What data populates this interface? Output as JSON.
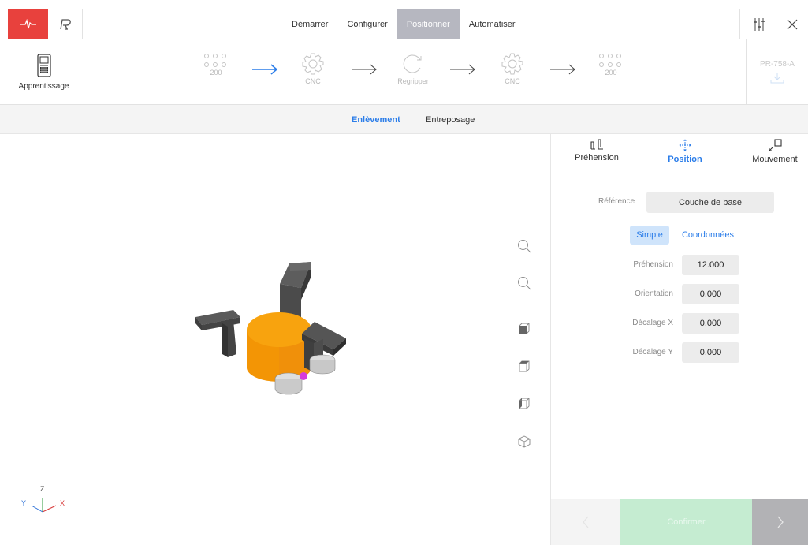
{
  "topbar": {
    "logo_icon": "pulse-icon",
    "brand_icon": "robotiq-r-icon",
    "menu": [
      {
        "label": "Démarrer",
        "active": false
      },
      {
        "label": "Configurer",
        "active": false
      },
      {
        "label": "Positionner",
        "active": true
      },
      {
        "label": "Automatiser",
        "active": false
      }
    ],
    "settings_icon": "sliders-icon",
    "close_icon": "close-icon"
  },
  "workflow": {
    "teach_label": "Apprentissage",
    "steps": [
      {
        "icon": "tray-icon",
        "label": "200"
      },
      {
        "icon": "gear-icon",
        "label": "CNC"
      },
      {
        "icon": "regrip-icon",
        "label": "Regripper"
      },
      {
        "icon": "gear-icon",
        "label": "CNC"
      },
      {
        "icon": "tray-icon",
        "label": "200"
      }
    ],
    "part_label": "PR-758-A"
  },
  "subtabs": [
    {
      "label": "Enlèvement",
      "active": true
    },
    {
      "label": "Entreposage",
      "active": false
    }
  ],
  "panel": {
    "tabs": [
      {
        "label": "Préhension",
        "icon": "gripper-icon",
        "active": false
      },
      {
        "label": "Position",
        "icon": "move-arrows-icon",
        "active": true
      },
      {
        "label": "Mouvement",
        "icon": "approach-icon",
        "active": false
      }
    ],
    "reference_label": "Référence",
    "reference_value": "Couche de base",
    "modes": [
      {
        "label": "Simple",
        "active": true
      },
      {
        "label": "Coordonnées",
        "active": false
      }
    ],
    "fields": [
      {
        "label": "Préhension",
        "value": "12.000"
      },
      {
        "label": "Orientation",
        "value": "0.000"
      },
      {
        "label": "Décalage X",
        "value": "0.000"
      },
      {
        "label": "Décalage Y",
        "value": "0.000"
      }
    ],
    "confirm_label": "Confirmer"
  },
  "viewer": {
    "axis_labels": {
      "z": "Z",
      "y": "Y",
      "x": "X"
    },
    "tools": [
      "zoom-in-icon",
      "zoom-out-icon",
      "view-front-icon",
      "view-top-icon",
      "view-side-icon",
      "view-iso-icon"
    ]
  },
  "colors": {
    "brand_red": "#e8413d",
    "accent_blue": "#2b7de9",
    "part_orange": "#f59a00",
    "finger_dark": "#4a4a4a",
    "confirm_green": "#c5ecd1"
  }
}
